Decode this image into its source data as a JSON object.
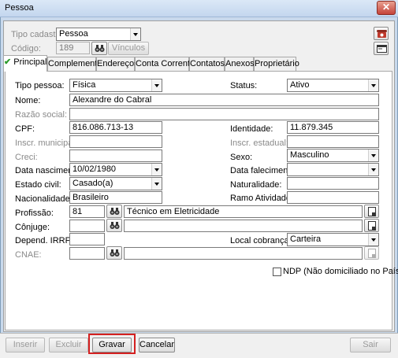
{
  "window": {
    "title": "Pessoa",
    "close_icon": "close-icon"
  },
  "header": {
    "tipo_cadastro_label": "Tipo cadastro:",
    "tipo_cadastro_value": "Pessoa",
    "codigo_label": "Código:",
    "codigo_value": "189",
    "vinculos_label": "Vínculos"
  },
  "tabs": [
    {
      "label": "Principal"
    },
    {
      "label": "Complementar"
    },
    {
      "label": "Endereços"
    },
    {
      "label": "Conta Corrente"
    },
    {
      "label": "Contatos"
    },
    {
      "label": "Anexos"
    },
    {
      "label": "Proprietário"
    }
  ],
  "form": {
    "tipo_pessoa": {
      "label": "Tipo pessoa:",
      "value": "Física"
    },
    "status": {
      "label": "Status:",
      "value": "Ativo"
    },
    "nome": {
      "label": "Nome:",
      "value": "Alexandre do Cabral"
    },
    "razao_social": {
      "label": "Razão social:",
      "value": ""
    },
    "cpf": {
      "label": "CPF:",
      "value": "816.086.713-13"
    },
    "identidade": {
      "label": "Identidade:",
      "value": "11.879.345"
    },
    "inscr_municipal": {
      "label": "Inscr. municipal:",
      "value": ""
    },
    "inscr_estadual": {
      "label": "Inscr. estadual:",
      "value": ""
    },
    "creci": {
      "label": "Creci:",
      "value": ""
    },
    "sexo": {
      "label": "Sexo:",
      "value": "Masculino"
    },
    "data_nascimento": {
      "label": "Data nascimento:",
      "value": "10/02/1980"
    },
    "data_falecimento": {
      "label": "Data falecimento:",
      "value": ""
    },
    "estado_civil": {
      "label": "Estado civil:",
      "value": "Casado(a)"
    },
    "naturalidade": {
      "label": "Naturalidade:",
      "value": ""
    },
    "nacionalidade": {
      "label": "Nacionalidade:",
      "value": "Brasileiro"
    },
    "ramo_atividade": {
      "label": "Ramo Atividade:",
      "value": ""
    },
    "profissao": {
      "label": "Profissão:",
      "code": "81",
      "description": "Técnico em Eletricidade"
    },
    "conjuge": {
      "label": "Cônjuge:",
      "code": "",
      "description": ""
    },
    "depend_irrf": {
      "label": "Depend. IRRF:",
      "value": ""
    },
    "local_cobranca": {
      "label": "Local cobrança:",
      "value": "Carteira"
    },
    "cnae": {
      "label": "CNAE:",
      "code": "",
      "description": ""
    },
    "ndp_label": "NDP (Não domiciliado no País)"
  },
  "buttons": {
    "inserir": "Inserir",
    "excluir": "Excluir",
    "gravar": "Gravar",
    "cancelar": "Cancelar",
    "sair": "Sair"
  }
}
